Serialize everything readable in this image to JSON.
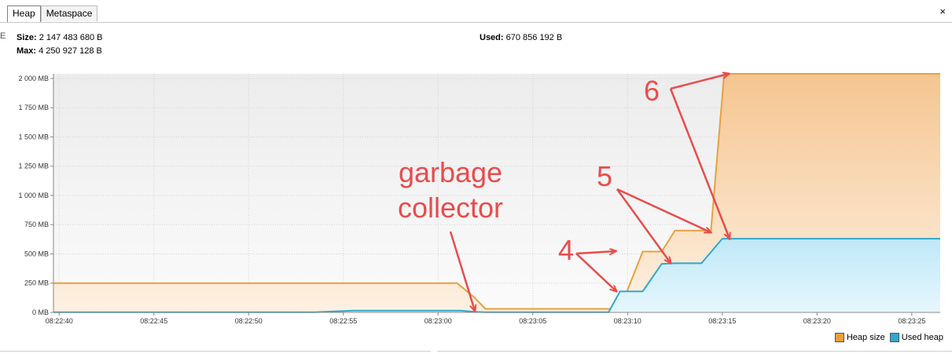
{
  "tabs": [
    {
      "label": "Heap",
      "active": true
    },
    {
      "label": "Metaspace",
      "active": false
    }
  ],
  "close_icon": "×",
  "left_marker": "E",
  "stats": {
    "size_label": "Size:",
    "size_value": "2 147 483 680 B",
    "max_label": "Max:",
    "max_value": "4 250 927 128 B",
    "used_label": "Used:",
    "used_value": "670 856 192 B"
  },
  "colors": {
    "heap_size_line": "#e8a03e",
    "heap_size_fill": "#f8c992",
    "used_heap_line": "#2ea8cf",
    "used_heap_fill": "#cdeef9",
    "annotation": "#e84c4c"
  },
  "chart_data": {
    "type": "area",
    "x_tick_labels": [
      "08:22:40",
      "08:22:45",
      "08:22:50",
      "08:22:55",
      "08:23:00",
      "08:23:05",
      "08:23:10",
      "08:23:15",
      "08:23:20",
      "08:23:25"
    ],
    "x_tick_seconds": [
      40,
      45,
      50,
      55,
      60,
      65,
      70,
      75,
      80,
      85
    ],
    "xlim": [
      39.7,
      86.5
    ],
    "y_tick_labels": [
      "0 MB",
      "250 MB",
      "500 MB",
      "750 MB",
      "1 000 MB",
      "1 250 MB",
      "1 500 MB",
      "1 750 MB",
      "2 000 MB"
    ],
    "y_tick_values": [
      0,
      250,
      500,
      750,
      1000,
      1250,
      1500,
      1750,
      2000
    ],
    "ylim": [
      0,
      2040
    ],
    "grid": true,
    "legend_position": "bottom-right",
    "series": [
      {
        "name": "Heap size",
        "x": [
          39.7,
          61.0,
          61.9,
          62.5,
          68.2,
          69.0,
          69.6,
          70.8,
          71.8,
          72.5,
          73.9,
          74.4,
          75.1,
          86.5
        ],
        "values": [
          250,
          250,
          130,
          30,
          30,
          30,
          30,
          520,
          520,
          700,
          700,
          700,
          2040,
          2040
        ]
      },
      {
        "name": "Used heap",
        "x": [
          39.7,
          53.5,
          55.5,
          59.0,
          61.2,
          61.9,
          62.5,
          68.2,
          69.0,
          69.6,
          70.8,
          71.8,
          72.5,
          73.9,
          75.0,
          86.5
        ],
        "values": [
          2,
          2,
          15,
          15,
          15,
          5,
          2,
          2,
          2,
          180,
          180,
          415,
          420,
          420,
          630,
          630
        ]
      }
    ],
    "legend": [
      "Heap size",
      "Used heap"
    ],
    "annotations": [
      "garbage\ncollector",
      "4",
      "5",
      "6"
    ]
  }
}
